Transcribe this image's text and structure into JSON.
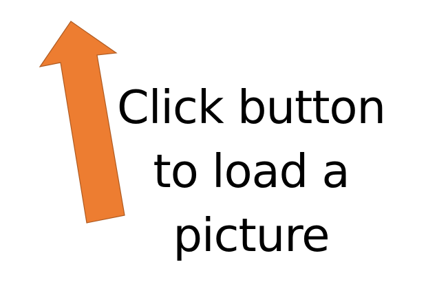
{
  "instruction": {
    "lines": [
      "Click button",
      "to load a",
      "picture"
    ]
  },
  "arrow": {
    "icon": "arrow-up-icon",
    "fill_color": "#ED7D31",
    "stroke_color": "#AE5A21"
  }
}
